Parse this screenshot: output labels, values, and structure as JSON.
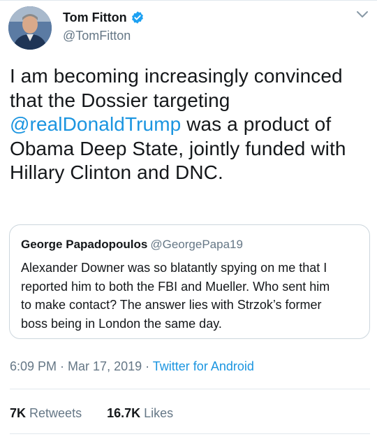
{
  "author": {
    "display_name": "Tom Fitton",
    "handle": "@TomFitton",
    "verified_icon": "verified-badge-icon",
    "menu_icon": "chevron-down-icon"
  },
  "tweet": {
    "lines": [
      "I am becoming increasingly convinced",
      "that the Dossier targeting"
    ],
    "mention": "@realDonaldTrump",
    "mention_tail": " was a product of",
    "lines_after": [
      "Obama Deep State, jointly funded with",
      "Hillary Clinton and DNC."
    ]
  },
  "quoted_tweet": {
    "display_name": "George Papadopoulos",
    "handle": "@GeorgePapa19",
    "lines": [
      "Alexander Downer was so blatantly spying on me that I",
      "reported him to both the FBI and Mueller. Who sent him",
      "to make contact? The answer lies with Strzok’s former",
      "boss being in London the same day."
    ]
  },
  "meta": {
    "time": "6:09 PM",
    "separator": " · ",
    "date": "Mar 17, 2019",
    "separator2": " · ",
    "source": "Twitter for Android"
  },
  "stats": {
    "retweets_count": "7K",
    "retweets_label": "Retweets",
    "likes_count": "16.7K",
    "likes_label": "Likes"
  },
  "colors": {
    "link": "#1b95e0",
    "secondary_text": "#657786",
    "border": "#ccd6dd"
  }
}
